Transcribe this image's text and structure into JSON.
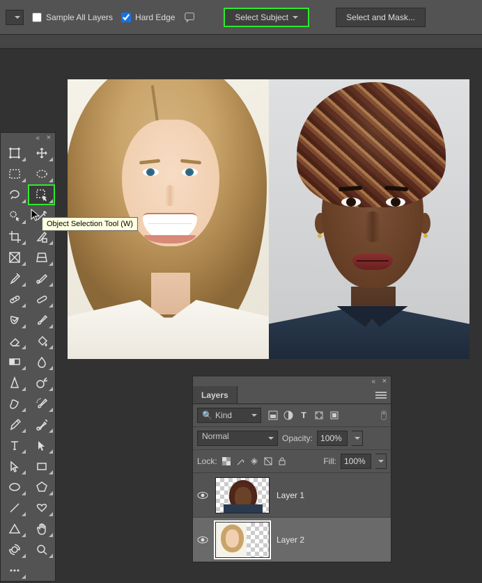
{
  "optionsBar": {
    "sampleAllLayers": {
      "label": "Sample All Layers",
      "checked": false
    },
    "hardEdge": {
      "label": "Hard Edge",
      "checked": true
    },
    "selectSubject": "Select Subject",
    "selectAndMask": "Select and Mask..."
  },
  "tooltip": "Object Selection Tool (W)",
  "tools": [
    {
      "name": "artboard-tool",
      "icon": "artboard"
    },
    {
      "name": "move-tool",
      "icon": "move"
    },
    {
      "name": "rectangular-marquee-tool",
      "icon": "marquee-rect"
    },
    {
      "name": "elliptical-marquee-tool",
      "icon": "marquee-ellipse"
    },
    {
      "name": "lasso-tool",
      "icon": "lasso"
    },
    {
      "name": "object-selection-tool",
      "icon": "object-select",
      "active": true,
      "highlight": true
    },
    {
      "name": "quick-selection-tool",
      "icon": "quick-select"
    },
    {
      "name": "magic-wand-tool",
      "icon": "wand"
    },
    {
      "name": "crop-tool",
      "icon": "crop"
    },
    {
      "name": "slice-tool",
      "icon": "slice"
    },
    {
      "name": "frame-tool",
      "icon": "frame"
    },
    {
      "name": "perspective-crop-tool",
      "icon": "perspective"
    },
    {
      "name": "eyedropper-tool",
      "icon": "eyedropper"
    },
    {
      "name": "color-sampler-tool",
      "icon": "sampler"
    },
    {
      "name": "spot-healing-brush-tool",
      "icon": "bandage"
    },
    {
      "name": "healing-brush-tool",
      "icon": "heal"
    },
    {
      "name": "patch-tool",
      "icon": "patch"
    },
    {
      "name": "brush-tool",
      "icon": "brush"
    },
    {
      "name": "eraser-tool",
      "icon": "eraser"
    },
    {
      "name": "paint-bucket-tool",
      "icon": "bucket"
    },
    {
      "name": "gradient-tool",
      "icon": "gradient"
    },
    {
      "name": "blur-tool",
      "icon": "blur"
    },
    {
      "name": "sharpen-tool",
      "icon": "sharpen"
    },
    {
      "name": "dodge-tool",
      "icon": "dodge"
    },
    {
      "name": "smudge-tool",
      "icon": "smudge"
    },
    {
      "name": "history-brush-tool",
      "icon": "historybrush"
    },
    {
      "name": "pen-tool",
      "icon": "pen"
    },
    {
      "name": "mixer-brush-tool",
      "icon": "mixer"
    },
    {
      "name": "type-tool",
      "icon": "type"
    },
    {
      "name": "path-selection-tool",
      "icon": "path-arrow"
    },
    {
      "name": "direct-selection-tool",
      "icon": "direct-arrow"
    },
    {
      "name": "rectangle-tool",
      "icon": "rect"
    },
    {
      "name": "ellipse-tool",
      "icon": "ellipse"
    },
    {
      "name": "polygon-tool",
      "icon": "polygon"
    },
    {
      "name": "line-tool",
      "icon": "line"
    },
    {
      "name": "custom-shape-tool",
      "icon": "custom"
    },
    {
      "name": "triangle-tool",
      "icon": "triangle"
    },
    {
      "name": "hand-tool",
      "icon": "hand"
    },
    {
      "name": "rotate-view-tool",
      "icon": "rotate"
    },
    {
      "name": "zoom-tool",
      "icon": "zoom"
    },
    {
      "name": "edit-toolbar",
      "icon": "dots"
    }
  ],
  "layersPanel": {
    "tab": "Layers",
    "kindLabel": "Kind",
    "blendMode": "Normal",
    "opacityLabel": "Opacity:",
    "opacityValue": "100%",
    "lockLabel": "Lock:",
    "fillLabel": "Fill:",
    "fillValue": "100%",
    "layers": [
      {
        "name": "Layer 1",
        "visible": true,
        "selected": false
      },
      {
        "name": "Layer 2",
        "visible": true,
        "selected": true
      }
    ]
  }
}
